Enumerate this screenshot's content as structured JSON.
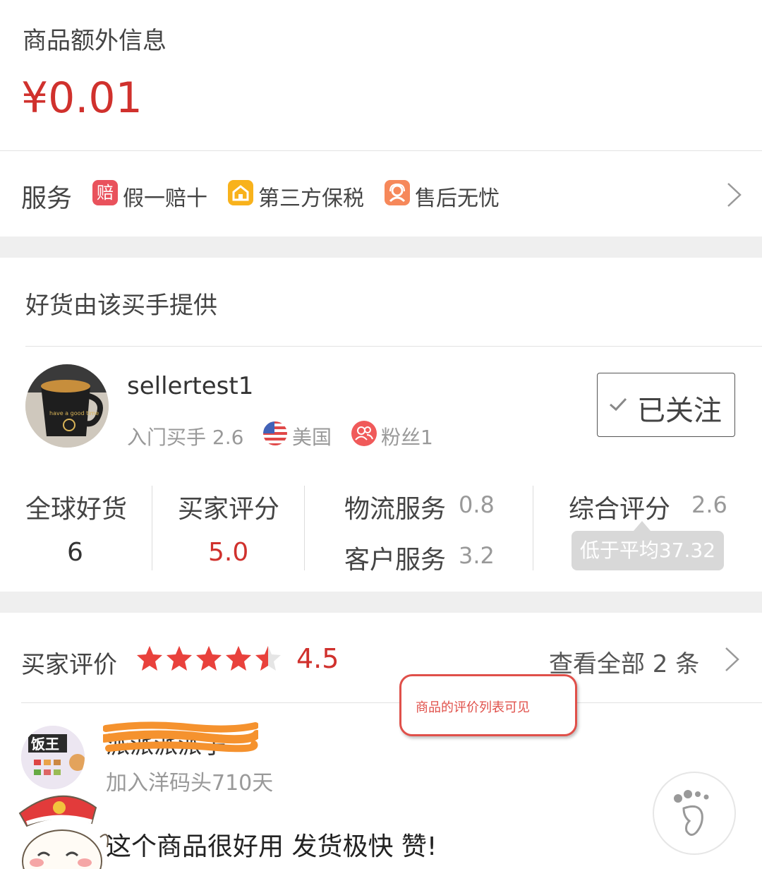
{
  "product": {
    "extra_info_title": "商品额外信息",
    "price": "¥0.01"
  },
  "service": {
    "label": "服务",
    "items": [
      {
        "icon": "compensate-icon",
        "icon_text": "赔",
        "label": "假一赔十",
        "color": "#e9525c"
      },
      {
        "icon": "bonded-warehouse-icon",
        "label": "第三方保税",
        "color": "#f8b21c"
      },
      {
        "icon": "after-sales-icon",
        "label": "售后无忧",
        "color": "#f6885a"
      }
    ]
  },
  "seller": {
    "section_title": "好货由该买手提供",
    "name": "sellertest1",
    "level": "入门买手 2.6",
    "country": "美国",
    "fans": "粉丝1",
    "follow_label": "已关注",
    "avatar_text": "have a good time"
  },
  "stats": {
    "global_goods_label": "全球好货",
    "global_goods_value": "6",
    "buyer_score_label": "买家评分",
    "buyer_score_value": "5.0",
    "logistics_label": "物流服务",
    "logistics_value": "0.8",
    "customer_label": "客户服务",
    "customer_value": "3.2",
    "overall_label": "综合评分",
    "overall_value": "2.6",
    "overall_note": "低于平均37.32"
  },
  "reviews": {
    "title": "买家评价",
    "rating": 4.5,
    "rating_text": "4.5",
    "view_all": "查看全部 2 条",
    "annotation": "商品的评价列表可见",
    "first": {
      "name_redacted": "派派派派子",
      "joined": "加入洋码头710天",
      "content": "这个商品很好用 发货极快 赞!",
      "avatar_text": "饭王"
    }
  },
  "colors": {
    "accent_red": "#d0312d",
    "star": "#e9413c",
    "annotation_border": "#e0504a"
  }
}
